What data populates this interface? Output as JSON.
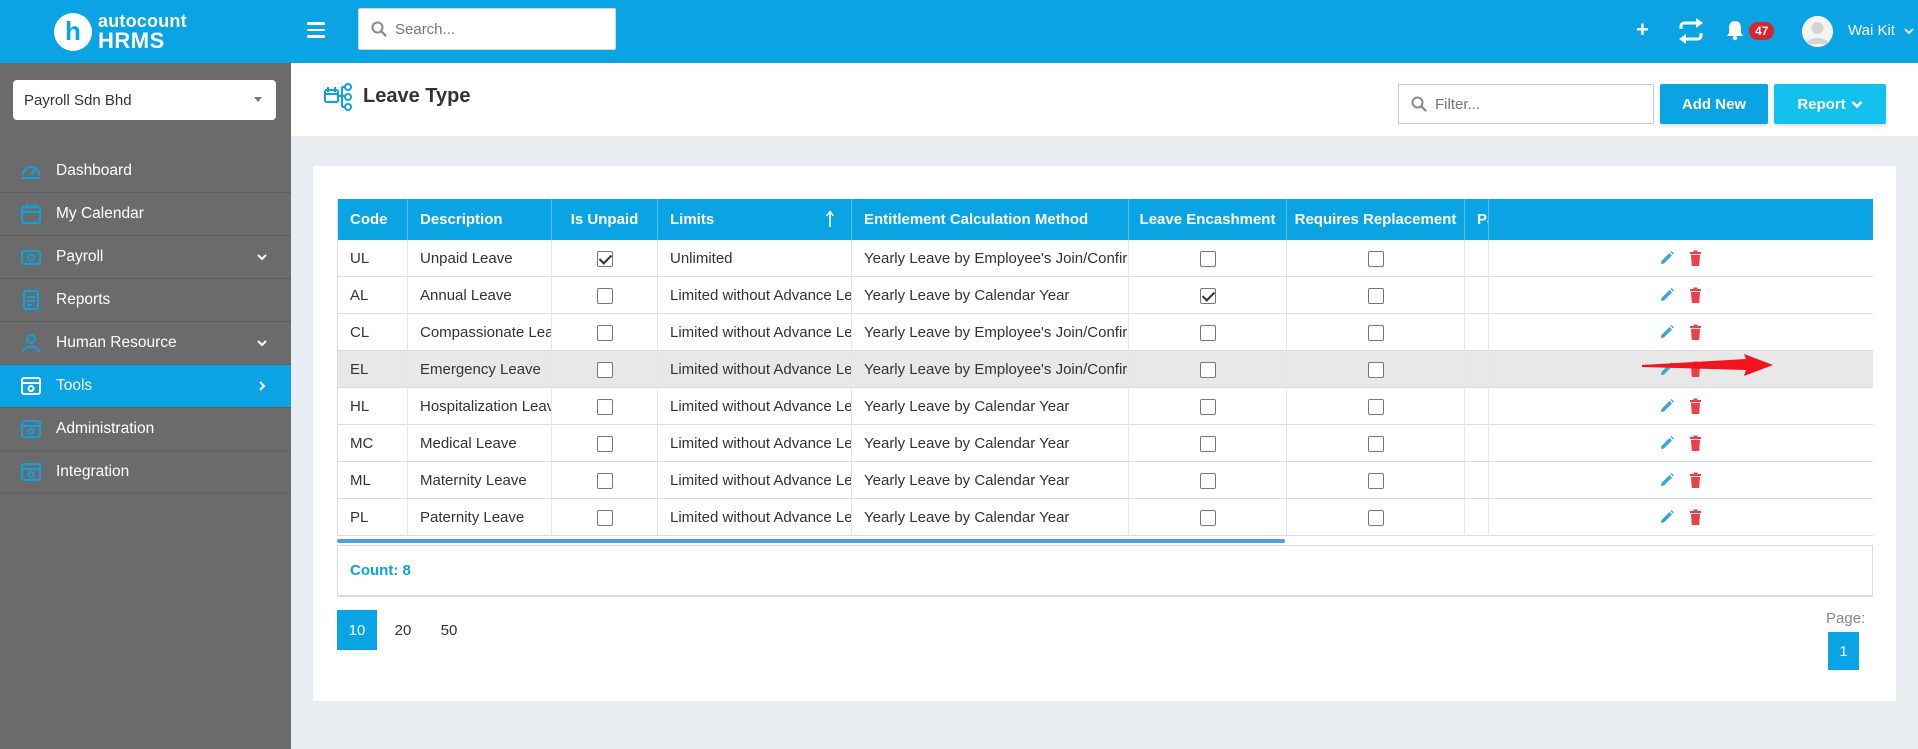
{
  "app": {
    "logo_small": "autocount",
    "logo_big": "HRMS",
    "logo_letter": "h"
  },
  "sidebar": {
    "company": "Payroll Sdn Bhd",
    "items": [
      {
        "label": "Dashboard",
        "icon": "dashboard-icon",
        "chevron": ""
      },
      {
        "label": "My Calendar",
        "icon": "calendar-icon",
        "chevron": ""
      },
      {
        "label": "Payroll",
        "icon": "payroll-icon",
        "chevron": "down"
      },
      {
        "label": "Reports",
        "icon": "reports-icon",
        "chevron": ""
      },
      {
        "label": "Human Resource",
        "icon": "human-resource-icon",
        "chevron": "down"
      },
      {
        "label": "Tools",
        "icon": "tools-icon",
        "chevron": "right",
        "active": true
      },
      {
        "label": "Administration",
        "icon": "administration-icon",
        "chevron": ""
      },
      {
        "label": "Integration",
        "icon": "integration-icon",
        "chevron": ""
      }
    ]
  },
  "topbar": {
    "search_placeholder": "Search...",
    "plus": "+",
    "notification_count": "47",
    "username": "Wai Kit"
  },
  "header": {
    "title": "Leave Type",
    "filter_placeholder": "Filter...",
    "add_new": "Add New",
    "report": "Report"
  },
  "grid": {
    "columns": [
      "Code",
      "Description",
      "Is Unpaid",
      "Limits",
      "Entitlement Calculation Method",
      "Leave Encashment",
      "Requires Replacement",
      "Pa"
    ],
    "rows": [
      {
        "code": "UL",
        "description": "Unpaid Leave",
        "is_unpaid": true,
        "limits": "Unlimited",
        "method": "Yearly Leave by Employee's Join/Confirm Date",
        "encashment": false,
        "replacement": false
      },
      {
        "code": "AL",
        "description": "Annual Leave",
        "is_unpaid": false,
        "limits": "Limited without Advance Leave",
        "method": "Yearly Leave by Calendar Year",
        "encashment": true,
        "replacement": false
      },
      {
        "code": "CL",
        "description": "Compassionate Leave",
        "is_unpaid": false,
        "limits": "Limited without Advance Leave",
        "method": "Yearly Leave by Employee's Join/Confirm Date",
        "encashment": false,
        "replacement": false
      },
      {
        "code": "EL",
        "description": "Emergency Leave",
        "is_unpaid": false,
        "limits": "Limited without Advance Leave",
        "method": "Yearly Leave by Employee's Join/Confirm Date",
        "encashment": false,
        "replacement": false
      },
      {
        "code": "HL",
        "description": "Hospitalization Leave",
        "is_unpaid": false,
        "limits": "Limited without Advance Leave",
        "method": "Yearly Leave by Calendar Year",
        "encashment": false,
        "replacement": false
      },
      {
        "code": "MC",
        "description": "Medical Leave",
        "is_unpaid": false,
        "limits": "Limited without Advance Leave",
        "method": "Yearly Leave by Calendar Year",
        "encashment": false,
        "replacement": false
      },
      {
        "code": "ML",
        "description": "Maternity Leave",
        "is_unpaid": false,
        "limits": "Limited without Advance Leave",
        "method": "Yearly Leave by Calendar Year",
        "encashment": false,
        "replacement": false
      },
      {
        "code": "PL",
        "description": "Paternity Leave",
        "is_unpaid": false,
        "limits": "Limited without Advance Leave",
        "method": "Yearly Leave by Calendar Year",
        "encashment": false,
        "replacement": false
      }
    ],
    "count_label": "Count: 8"
  },
  "pager": {
    "sizes": [
      "10",
      "20",
      "50"
    ],
    "page_label": "Page:",
    "current_page": "1"
  },
  "colors": {
    "primary": "#0aa3e3",
    "sidebar": "#6b6b6b",
    "delete": "#e8414b",
    "badge": "#d9262b"
  }
}
